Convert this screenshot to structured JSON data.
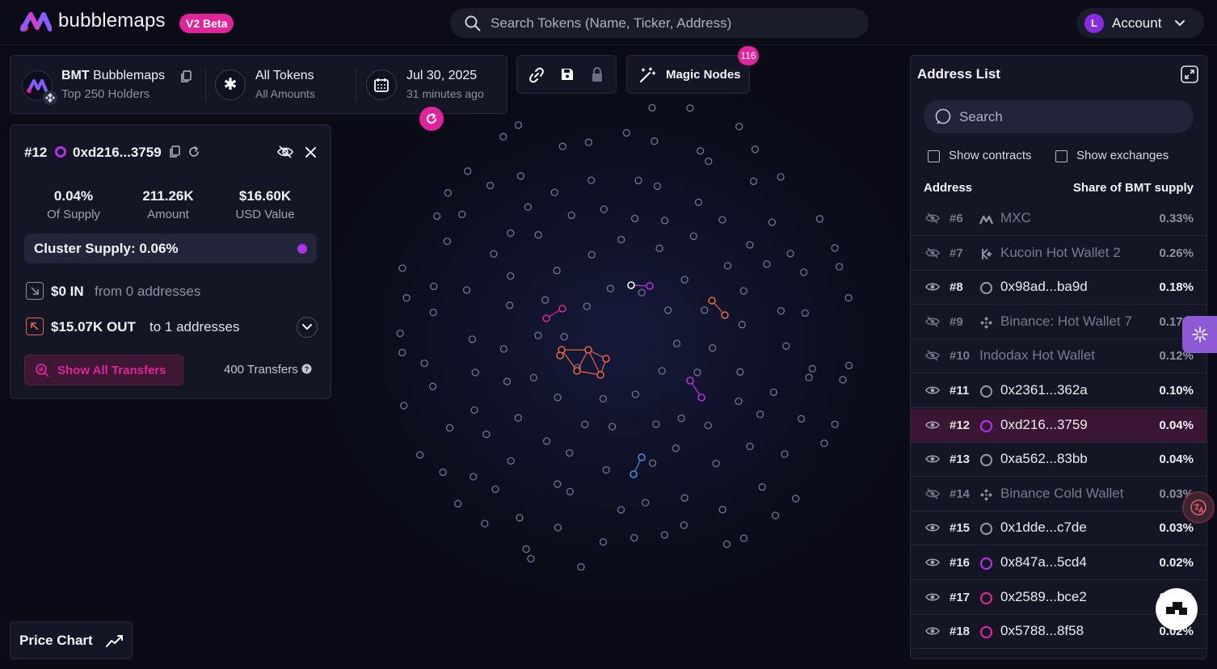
{
  "app": {
    "brand": "bubblemaps",
    "beta_badge": "V2 Beta",
    "search_placeholder": "Search Tokens (Name, Ticker, Address)",
    "account_initial": "L",
    "account_label": "Account"
  },
  "token": {
    "ticker": "BMT",
    "name": "Bubblemaps",
    "subtitle": "Top 250 Holders",
    "filter_title": "All Tokens",
    "filter_sub": "All Amounts",
    "date": "Jul 30, 2025",
    "date_sub": "31 minutes ago"
  },
  "toolbar": {
    "magic_nodes_label": "Magic Nodes",
    "magic_nodes_count": "116"
  },
  "detail": {
    "rank": "#12",
    "address": "0xd216...3759",
    "stats": [
      {
        "value": "0.04%",
        "label": "Of Supply"
      },
      {
        "value": "211.26K",
        "label": "Amount"
      },
      {
        "value": "$16.60K",
        "label": "USD Value"
      }
    ],
    "cluster_supply": "Cluster Supply: 0.06%",
    "in_amount": "$0 IN",
    "in_sub": "from 0 addresses",
    "out_amount": "$15.07K OUT",
    "out_sub": "to 1 addresses",
    "show_transfers": "Show All Transfers",
    "transfers_count": "400 Transfers"
  },
  "price_chart_label": "Price Chart",
  "address_list": {
    "title": "Address List",
    "search_placeholder": "Search",
    "show_contracts": "Show contracts",
    "show_exchanges": "Show exchanges",
    "col_address": "Address",
    "col_share": "Share of BMT supply",
    "rows": [
      {
        "rank": "#6",
        "name": "MXC",
        "share": "0.33%",
        "hidden": true,
        "icon": "mxc-icon"
      },
      {
        "rank": "#7",
        "name": "Kucoin Hot Wallet 2",
        "share": "0.26%",
        "hidden": true,
        "icon": "kucoin-icon"
      },
      {
        "rank": "#8",
        "name": "0x98ad...ba9d",
        "share": "0.18%",
        "hidden": false,
        "icon": "wallet-ring-icon"
      },
      {
        "rank": "#9",
        "name": "Binance: Hot Wallet 7",
        "share": "0.17%",
        "hidden": true,
        "icon": "binance-icon"
      },
      {
        "rank": "#10",
        "name": "Indodax Hot Wallet",
        "share": "0.12%",
        "hidden": true,
        "icon": ""
      },
      {
        "rank": "#11",
        "name": "0x2361...362a",
        "share": "0.10%",
        "hidden": false,
        "icon": "wallet-ring-icon"
      },
      {
        "rank": "#12",
        "name": "0xd216...3759",
        "share": "0.04%",
        "hidden": false,
        "icon": "wallet-ring-purple-icon",
        "selected": true
      },
      {
        "rank": "#13",
        "name": "0xa562...83bb",
        "share": "0.04%",
        "hidden": false,
        "icon": "wallet-ring-icon"
      },
      {
        "rank": "#14",
        "name": "Binance Cold Wallet",
        "share": "0.03%",
        "hidden": true,
        "icon": "binance-icon"
      },
      {
        "rank": "#15",
        "name": "0x1dde...c7de",
        "share": "0.03%",
        "hidden": false,
        "icon": "wallet-ring-icon"
      },
      {
        "rank": "#16",
        "name": "0x847a...5cd4",
        "share": "0.02%",
        "hidden": false,
        "icon": "wallet-ring-purple-icon"
      },
      {
        "rank": "#17",
        "name": "0x2589...bce2",
        "share": "0.02%",
        "hidden": false,
        "icon": "wallet-ring-pink-icon"
      },
      {
        "rank": "#18",
        "name": "0x5788...8f58",
        "share": "0.02%",
        "hidden": false,
        "icon": "wallet-ring-pink-icon"
      }
    ]
  },
  "colors": {
    "accent": "#e0249b",
    "purple": "#b233e6",
    "bubble": "#6f7494",
    "cluster_orange": "#e8624a",
    "cluster_pink": "#e0249b",
    "cluster_blue": "#4a90d9"
  }
}
